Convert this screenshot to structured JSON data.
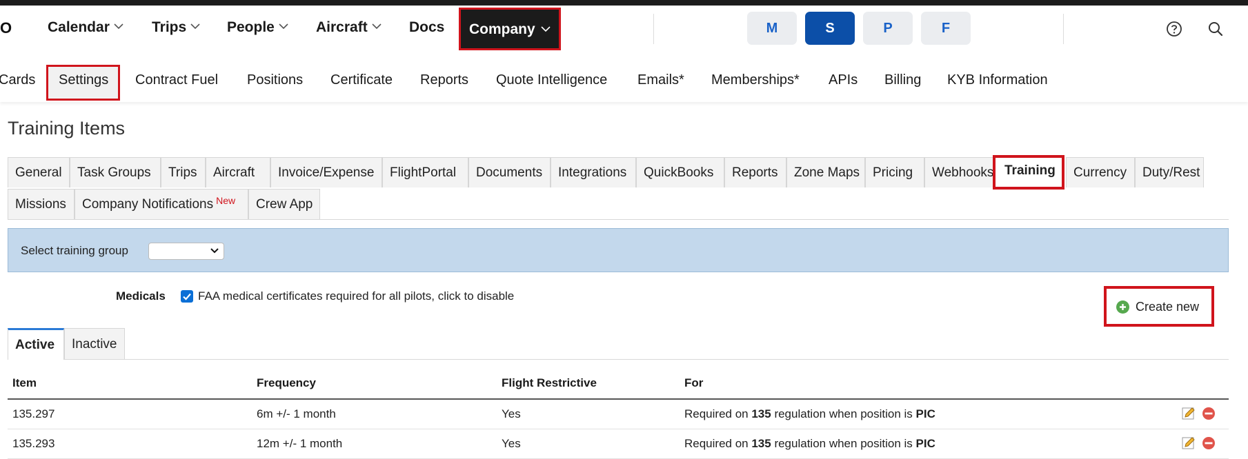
{
  "colors": {
    "accent_blue": "#0c4fa8",
    "highlight_red": "#d0141c",
    "group_bar": "#c3d8ec"
  },
  "main_nav": {
    "logo_fragment": "O",
    "items": [
      "Calendar",
      "Trips",
      "People",
      "Aircraft",
      "Docs"
    ],
    "company_label": "Company",
    "mode_buttons": [
      "M",
      "S",
      "P",
      "F"
    ],
    "active_mode": "S",
    "icons": [
      "help-icon",
      "search-icon"
    ]
  },
  "sub_nav": {
    "items": [
      "Cards",
      "Settings",
      "Contract Fuel",
      "Positions",
      "Certificate",
      "Reports",
      "Quote Intelligence",
      "Emails*",
      "Memberships*",
      "APIs",
      "Billing",
      "KYB Information"
    ],
    "active": "Settings"
  },
  "page_title": "Training Items",
  "settings_tabs": {
    "row1": [
      "General",
      "Task Groups",
      "Trips",
      "Aircraft",
      "Invoice/Expense",
      "FlightPortal",
      "Documents",
      "Integrations",
      "QuickBooks",
      "Reports",
      "Zone Maps",
      "Pricing",
      "Webhooks",
      "Training",
      "Currency",
      "Duty/Rest"
    ],
    "row2": [
      "Missions",
      "Company Notifications",
      "Crew App"
    ],
    "new_badge": "New",
    "active": "Training"
  },
  "group_select": {
    "label": "Select training group",
    "value": ""
  },
  "medicals": {
    "label": "Medicals",
    "checked": true,
    "text": "FAA medical certificates required for all pilots, click to disable"
  },
  "create_button": {
    "label": "Create new"
  },
  "status_tabs": {
    "active": "Active",
    "inactive": "Inactive"
  },
  "table": {
    "headers": [
      "Item",
      "Frequency",
      "Flight Restrictive",
      "For"
    ],
    "rows": [
      {
        "item": "135.297",
        "frequency": "6m +/- 1 month",
        "restrictive": "Yes",
        "for_prefix": "Required on ",
        "regulation": "135",
        "for_mid": " regulation when position is ",
        "position": "PIC"
      },
      {
        "item": "135.293",
        "frequency": "12m +/- 1 month",
        "restrictive": "Yes",
        "for_prefix": "Required on ",
        "regulation": "135",
        "for_mid": " regulation when position is ",
        "position": "PIC"
      }
    ]
  }
}
